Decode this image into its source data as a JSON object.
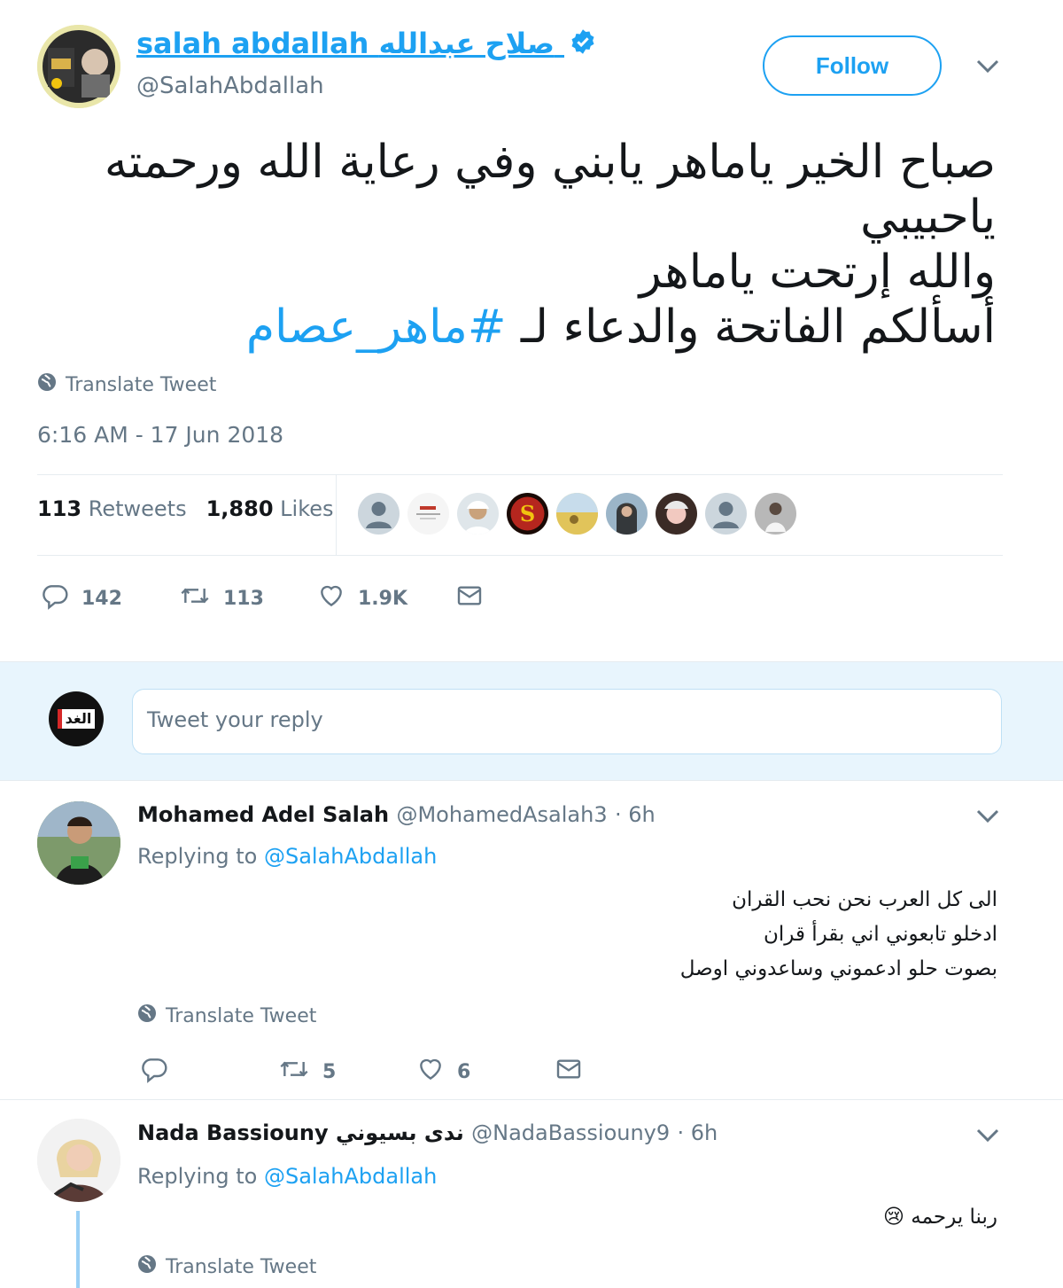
{
  "tweet": {
    "display_name": "salah abdallah صلاح عبدالله",
    "handle": "@SalahAbdallah",
    "follow_label": "Follow",
    "lines": [
      "صباح الخير ياماهر يابني وفي رعاية الله ورحمته",
      "ياحبيبي",
      "والله إرتحت ياماهر"
    ],
    "last_line_text": "أسألكم الفاتحة والدعاء لـ ",
    "hashtag": "#ماهر_عصام",
    "translate_label": "Translate Tweet",
    "timestamp": "6:16 AM - 17 Jun 2018",
    "retweets_count": "113",
    "retweets_label": "Retweets",
    "likes_count": "1,880",
    "likes_label": "Likes",
    "actions": {
      "replies": "142",
      "retweets": "113",
      "likes": "1.9K"
    }
  },
  "reply_box": {
    "placeholder": "Tweet your reply",
    "avatar_text": "الغد"
  },
  "replies": [
    {
      "name": "Mohamed Adel Salah",
      "handle": "@MohamedAsalah3",
      "time": "· 6h",
      "replying_label": "Replying to",
      "replying_handle": "@SalahAbdallah",
      "lines": [
        "الى كل العرب نحن نحب القران",
        "ادخلو تابعوني اني بقرأ قران",
        "بصوت حلو ادعموني وساعدوني اوصل"
      ],
      "translate_label": "Translate Tweet",
      "retweets": "5",
      "likes": "6"
    },
    {
      "name": "Nada Bassiouny ندى بسيوني",
      "handle": "@NadaBassiouny9",
      "time": "· 6h",
      "replying_label": "Replying to",
      "replying_handle": "@SalahAbdallah",
      "text": "ربنا يرحمه",
      "emoji": "😢",
      "translate_label": "Translate Tweet"
    }
  ],
  "colors": {
    "accent": "#1da1f2",
    "muted": "#657786",
    "reply_bg": "#e8f5fd"
  }
}
